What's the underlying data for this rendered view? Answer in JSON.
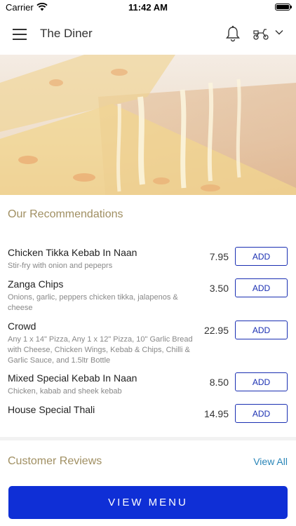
{
  "status_bar": {
    "carrier": "Carrier",
    "time": "11:42 AM"
  },
  "header": {
    "title": "The Diner"
  },
  "recommendations": {
    "title": "Our Recommendations",
    "items": [
      {
        "name": "Chicken Tikka Kebab In Naan",
        "description": "Stir-fry with onion and pepeprs",
        "price": "7.95",
        "button": "ADD"
      },
      {
        "name": "Zanga Chips",
        "description": "Onions, garlic, peppers chicken tikka, jalapenos & cheese",
        "price": "3.50",
        "button": "ADD"
      },
      {
        "name": "Crowd",
        "description": "Any 1 x 14\" Pizza, Any 1 x 12\" Pizza, 10\" Garlic Bread with Cheese, Chicken Wings, Kebab & Chips, Chilli & Garlic Sauce, and 1.5ltr Bottle",
        "price": "22.95",
        "button": "ADD"
      },
      {
        "name": "Mixed Special Kebab In Naan",
        "description": "Chicken, kabab and sheek kebab",
        "price": "8.50",
        "button": "ADD"
      },
      {
        "name": "House Special Thali",
        "description": "",
        "price": "14.95",
        "button": "ADD"
      }
    ]
  },
  "reviews": {
    "title": "Customer Reviews",
    "view_all": "View All"
  },
  "footer": {
    "view_menu": "VIEW MENU"
  },
  "colors": {
    "accent": "#0f2fd6",
    "section_title": "#a08f62",
    "link": "#2a86b8"
  },
  "icons": [
    "wifi-icon",
    "battery-icon",
    "hamburger-menu-icon",
    "bell-icon",
    "scooter-icon",
    "chevron-down-icon"
  ]
}
